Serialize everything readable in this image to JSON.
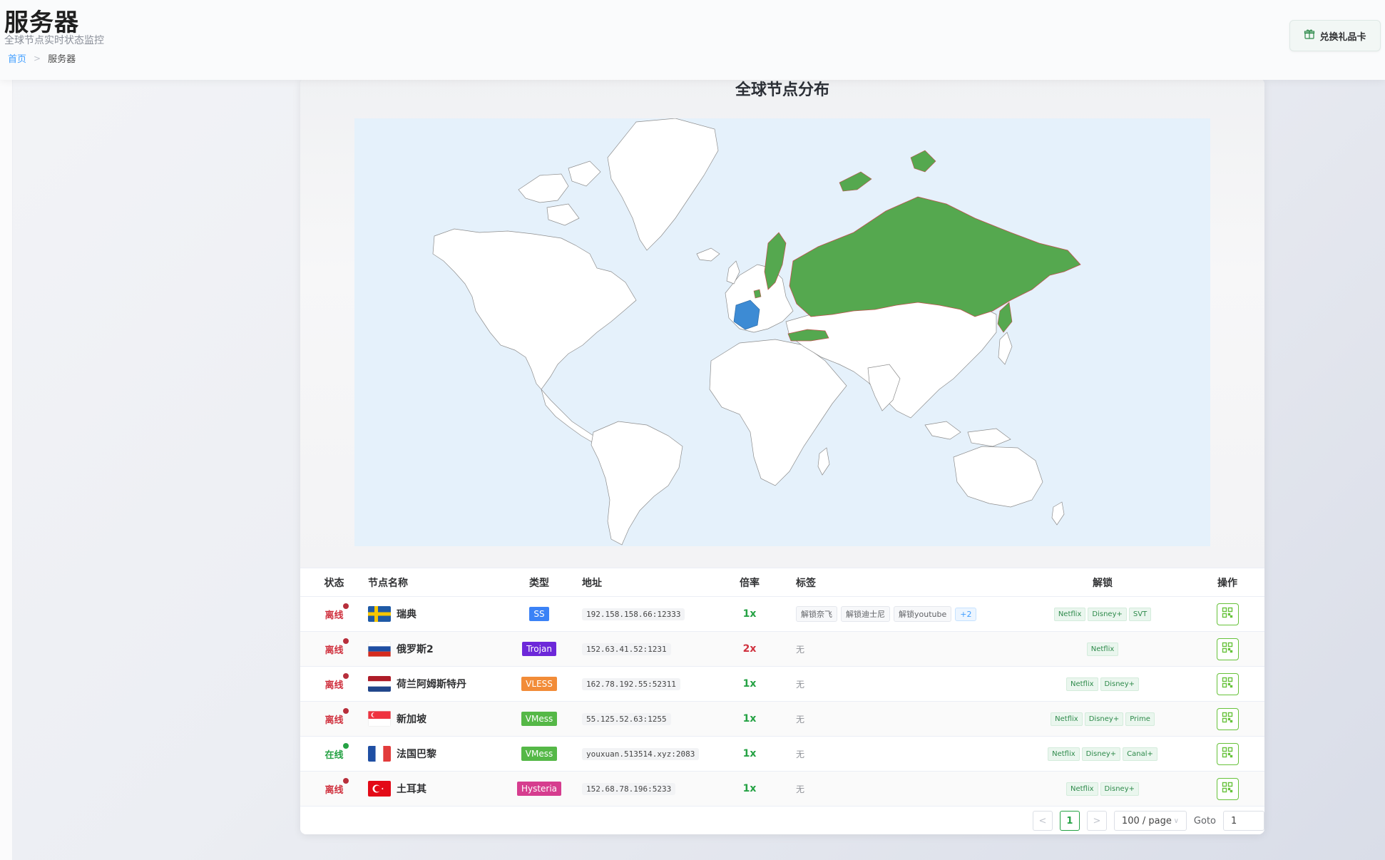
{
  "header": {
    "title": "服务器",
    "subtitle": "全球节点实时状态监控",
    "breadcrumb": {
      "home": "首页",
      "separator": ">",
      "current": "服务器"
    },
    "gift_button": "兑换礼品卡"
  },
  "map": {
    "title": "全球节点分布",
    "colors": {
      "active_country": "#55a84f",
      "online_country": "#3d8bd4",
      "land": "#ffffff",
      "ocean": "#e5f1fb",
      "border": "#8c8c8c"
    },
    "highlighted_countries": [
      "Russia",
      "Sweden",
      "Netherlands",
      "Singapore",
      "Turkey",
      "France"
    ]
  },
  "table": {
    "headers": {
      "status": "状态",
      "name": "节点名称",
      "type": "类型",
      "address": "地址",
      "rate": "倍率",
      "tags": "标签",
      "unlock": "解锁",
      "actions": "操作"
    },
    "rows": [
      {
        "status": "离线",
        "name": "瑞典",
        "flag": "SE",
        "type": "SS",
        "type_color": "#3b82f6",
        "address": "192.158.158.66:12333",
        "rate": "1x",
        "tags": [
          "解锁奈飞",
          "解锁迪士尼",
          "解锁youtube"
        ],
        "tags_more": "+2",
        "unlock": [
          "Netflix",
          "Disney+",
          "SVT"
        ]
      },
      {
        "status": "离线",
        "name": "俄罗斯2",
        "flag": "RU",
        "type": "Trojan",
        "type_color": "#6d28d9",
        "address": "152.63.41.52:1231",
        "rate": "2x",
        "tags_none": "无",
        "unlock": [
          "Netflix"
        ]
      },
      {
        "status": "离线",
        "name": "荷兰阿姆斯特丹",
        "flag": "NL",
        "type": "VLESS",
        "type_color": "#f28c38",
        "address": "162.78.192.55:52311",
        "rate": "1x",
        "tags_none": "无",
        "unlock": [
          "Netflix",
          "Disney+"
        ]
      },
      {
        "status": "离线",
        "name": "新加坡",
        "flag": "SG",
        "type": "VMess",
        "type_color": "#55b847",
        "address": "55.125.52.63:1255",
        "rate": "1x",
        "tags_none": "无",
        "unlock": [
          "Netflix",
          "Disney+",
          "Prime"
        ]
      },
      {
        "status": "在线",
        "name": "法国巴黎",
        "flag": "FR",
        "type": "VMess",
        "type_color": "#55b847",
        "address": "youxuan.513514.xyz:2083",
        "rate": "1x",
        "tags_none": "无",
        "unlock": [
          "Netflix",
          "Disney+",
          "Canal+"
        ]
      },
      {
        "status": "离线",
        "name": "土耳其",
        "flag": "TR",
        "type": "Hysteria",
        "type_color": "#d63d8f",
        "address": "152.68.78.196:5233",
        "rate": "1x",
        "tags_none": "无",
        "unlock": [
          "Netflix",
          "Disney+"
        ]
      }
    ]
  },
  "pagination": {
    "prev": "<",
    "current_page": "1",
    "next": ">",
    "page_size": "100 / page",
    "goto_label": "Goto",
    "goto_value": "1"
  }
}
